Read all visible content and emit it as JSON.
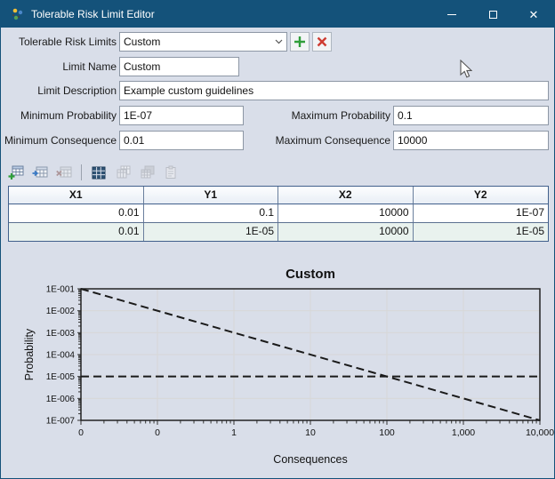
{
  "window": {
    "title": "Tolerable Risk Limit Editor",
    "titlebar_color": "#14527A",
    "background_color": "#D9DEE9",
    "controls": {
      "minimize": "–",
      "maximize": "",
      "close": "✕"
    }
  },
  "form": {
    "risk_limits": {
      "label": "Tolerable Risk Limits",
      "value": "Custom"
    },
    "add_button_color": "#2F9E3A",
    "delete_button_color": "#CE3C32",
    "limit_name": {
      "label": "Limit Name",
      "value": "Custom"
    },
    "limit_description": {
      "label": "Limit Description",
      "value": "Example custom guidelines"
    },
    "min_probability": {
      "label": "Minimum Probability",
      "value": "1E-07"
    },
    "max_probability": {
      "label": "Maximum Probability",
      "value": "0.1"
    },
    "min_consequence": {
      "label": "Minimum Consequence",
      "value": "0.01"
    },
    "max_consequence": {
      "label": "Maximum Consequence",
      "value": "10000"
    }
  },
  "toolbar": {
    "buttons": [
      {
        "name": "add-table-row",
        "enabled": true
      },
      {
        "name": "insert-table-row",
        "enabled": true
      },
      {
        "name": "delete-table-row",
        "enabled": false
      },
      {
        "name": "select-all-cells",
        "enabled": true
      },
      {
        "name": "copy-cells",
        "enabled": false
      },
      {
        "name": "copy-cells-with-headers",
        "enabled": false
      },
      {
        "name": "paste-cells",
        "enabled": false
      }
    ]
  },
  "table": {
    "columns": [
      "X1",
      "Y1",
      "X2",
      "Y2"
    ],
    "rows": [
      [
        "0.01",
        "0.1",
        "10000",
        "1E-07"
      ],
      [
        "0.01",
        "1E-05",
        "10000",
        "1E-05"
      ]
    ]
  },
  "chart_data": {
    "type": "line",
    "title": "Custom",
    "xlabel": "Consequences",
    "ylabel": "Probability",
    "x_scale": "log",
    "y_scale": "log",
    "xlim": [
      0.01,
      10000
    ],
    "ylim": [
      1e-07,
      0.1
    ],
    "grid": true,
    "legend": "none",
    "x_tick_labels": [
      "0",
      "0",
      "1",
      "10",
      "100",
      "1,000",
      "10,000"
    ],
    "y_tick_labels": [
      "1E-001",
      "1E-002",
      "1E-003",
      "1E-004",
      "1E-005",
      "1E-006",
      "1E-007"
    ],
    "series": [
      {
        "name": "sloped-risk-limit",
        "style": "dashed",
        "color": "#1a1a1a",
        "points": [
          [
            0.01,
            0.1
          ],
          [
            10000,
            1e-07
          ]
        ]
      },
      {
        "name": "horizontal-risk-limit",
        "style": "dashed",
        "color": "#1a1a1a",
        "points": [
          [
            0.01,
            1e-05
          ],
          [
            10000,
            1e-05
          ]
        ]
      }
    ]
  }
}
